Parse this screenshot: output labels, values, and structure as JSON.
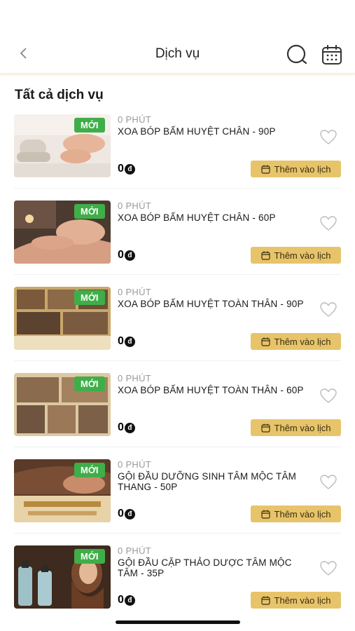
{
  "header": {
    "title": "Dịch vụ",
    "back_icon": "chevron-left-icon",
    "search_icon": "search-icon",
    "calendar_icon": "calendar-icon"
  },
  "section_title": "Tất cả dịch vụ",
  "colors": {
    "accent": "#e7c46a",
    "badge": "#3fae49",
    "heart": "#bbbbbb"
  },
  "services": [
    {
      "badge": "MỚI",
      "duration": "0 PHÚT",
      "name": "XOA BÓP BẤM HUYỆT CHÂN - 90P",
      "price": "0",
      "currency": "đ",
      "button": "Thêm vào lịch"
    },
    {
      "badge": "MỚI",
      "duration": "0 PHÚT",
      "name": "XOA BÓP BẤM HUYỆT CHÂN - 60P",
      "price": "0",
      "currency": "đ",
      "button": "Thêm vào lịch"
    },
    {
      "badge": "MỚI",
      "duration": "0 PHÚT",
      "name": "XOA BÓP BẤM HUYỆT TOÀN THÂN - 90P",
      "price": "0",
      "currency": "đ",
      "button": "Thêm vào lịch"
    },
    {
      "badge": "MỚI",
      "duration": "0 PHÚT",
      "name": "XOA BÓP BẤM HUYỆT TOÀN THÂN - 60P",
      "price": "0",
      "currency": "đ",
      "button": "Thêm vào lịch"
    },
    {
      "badge": "MỚI",
      "duration": "0 PHÚT",
      "name": "GỘI ĐẦU DƯỠNG SINH TÂM MỘC TÂM THANG - 50P",
      "price": "0",
      "currency": "đ",
      "button": "Thêm vào lịch"
    },
    {
      "badge": "MỚI",
      "duration": "0 PHÚT",
      "name": "GỘI ĐẦU CẶP THẢO DƯỢC TÂM MỘC TÂM - 35P",
      "price": "0",
      "currency": "đ",
      "button": "Thêm vào lịch"
    }
  ]
}
